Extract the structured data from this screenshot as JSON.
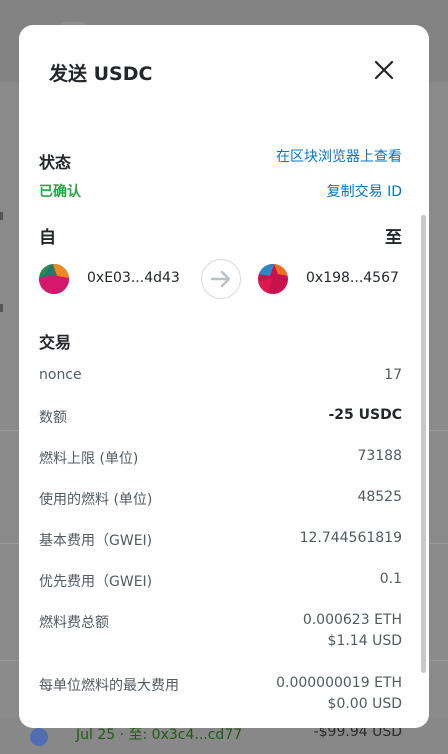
{
  "background": {
    "activity_row": {
      "date": "Jul 25",
      "separator": "·",
      "to_text": "至: 0x3c4...cd77",
      "amount": "-$99.94 USD"
    }
  },
  "modal": {
    "title": "发送 USDC",
    "status": {
      "heading": "状态",
      "value": "已确认",
      "view_explorer_link": "在区块浏览器上查看",
      "copy_tx_id_link": "复制交易 ID"
    },
    "parties": {
      "from_heading": "自",
      "to_heading": "至",
      "from_address": "0xE03...4d43",
      "to_address": "0x198...4567"
    },
    "transaction": {
      "heading": "交易",
      "rows": [
        {
          "label": "nonce",
          "value": "17"
        },
        {
          "label": "数额",
          "value": "-25 USDC"
        },
        {
          "label": "燃料上限 (单位)",
          "value": "73188"
        },
        {
          "label": "使用的燃料 (单位)",
          "value": "48525"
        },
        {
          "label": "基本费用（GWEI)",
          "value": "12.744561819"
        },
        {
          "label": "优先费用（GWEI)",
          "value": "0.1"
        },
        {
          "label": "燃料费总额",
          "value": "0.000623 ETH",
          "value2": "$1.14 USD"
        },
        {
          "label": "每单位燃料的最大费用",
          "value": "0.000000019 ETH",
          "value2": "$0.00 USD"
        }
      ]
    },
    "colors": {
      "link": "#0376c9",
      "confirmed": "#28a745",
      "text": "#24272a"
    }
  }
}
